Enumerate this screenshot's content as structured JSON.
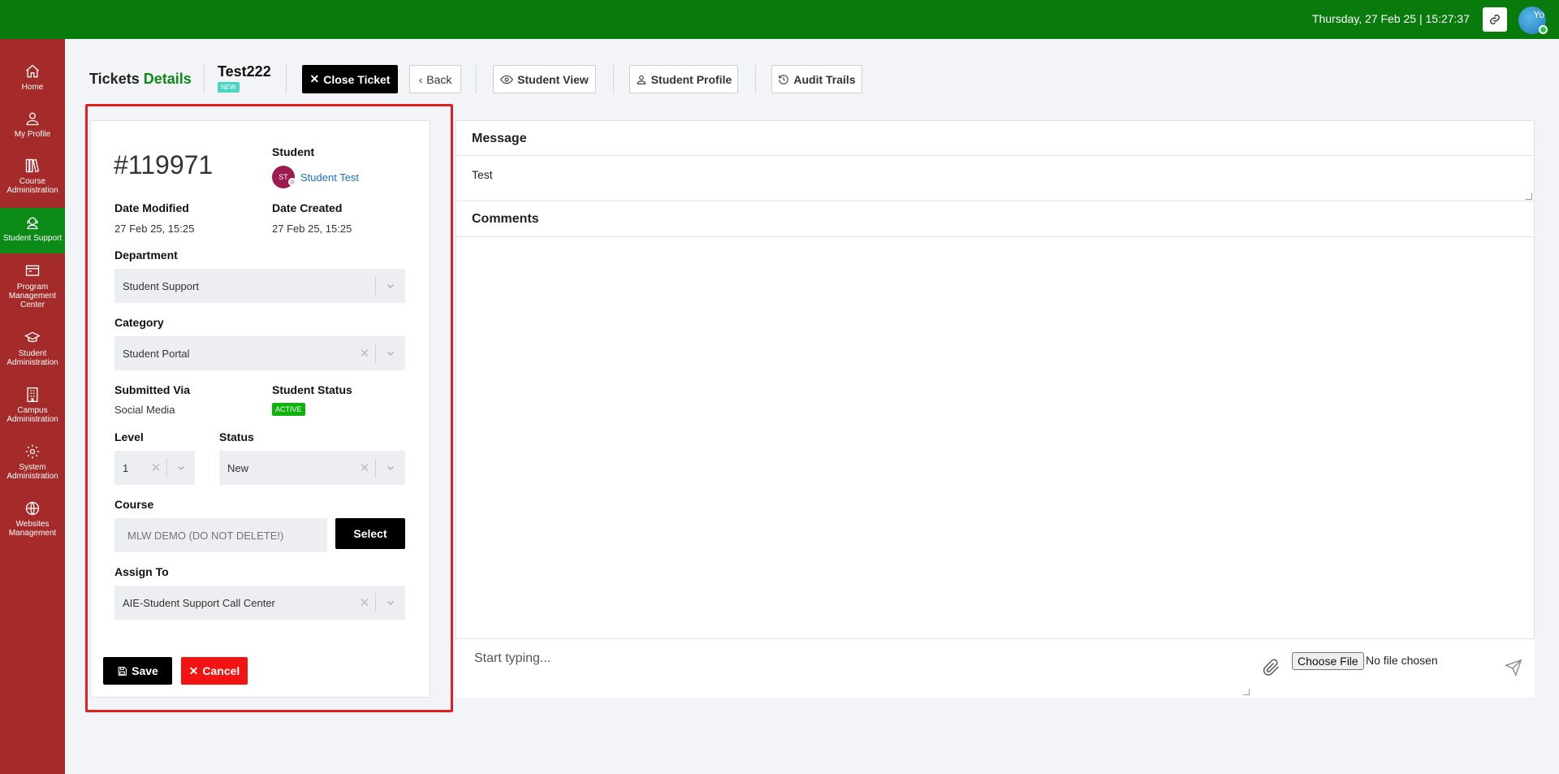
{
  "header": {
    "datetime": "Thursday, 27 Feb 25 | 15:27:37",
    "avatar_text": "Yo"
  },
  "sidebar": {
    "items": [
      {
        "label": "Home"
      },
      {
        "label": "My Profile"
      },
      {
        "label": "Course Administration"
      },
      {
        "label": "Student Support",
        "active": true
      },
      {
        "label": "Program Management Center"
      },
      {
        "label": "Student Administration"
      },
      {
        "label": "Campus Administration"
      },
      {
        "label": "System Administration"
      },
      {
        "label": "Websites Management"
      }
    ]
  },
  "page": {
    "title_prefix": "Tickets",
    "title_accent": "Details",
    "ticket_name": "Test222",
    "ticket_badge": "NEW"
  },
  "toolbar": {
    "close_ticket": "Close Ticket",
    "back": "Back",
    "student_view": "Student View",
    "student_profile": "Student Profile",
    "audit_trails": "Audit Trails"
  },
  "ticket": {
    "number": "#119971",
    "student_label": "Student",
    "student_initials": "ST",
    "student_name": "Student Test",
    "date_modified_label": "Date Modified",
    "date_modified": "27 Feb 25, 15:25",
    "date_created_label": "Date Created",
    "date_created": "27 Feb 25, 15:25",
    "department_label": "Department",
    "department": "Student Support",
    "category_label": "Category",
    "category": "Student Portal",
    "submitted_via_label": "Submitted Via",
    "submitted_via": "Social Media",
    "student_status_label": "Student Status",
    "student_status": "ACTIVE",
    "level_label": "Level",
    "level": "1",
    "status_label": "Status",
    "status": "New",
    "course_label": "Course",
    "course_placeholder": "MLW DEMO (DO NOT DELETE!)",
    "select_button": "Select",
    "assign_to_label": "Assign To",
    "assign_to": "AIE-Student Support Call Center",
    "save_button": "Save",
    "cancel_button": "Cancel"
  },
  "message": {
    "title": "Message",
    "text": "Test"
  },
  "comments": {
    "title": "Comments",
    "reply_placeholder": "Start typing...",
    "choose_file": "Choose File",
    "no_file": "No file chosen"
  },
  "colors": {
    "topbar": "#097b0d",
    "sidebar": "#a52a2a",
    "sidebar_active": "#0c8a17",
    "highlight": "#e32020",
    "cancel": "#f31313"
  }
}
